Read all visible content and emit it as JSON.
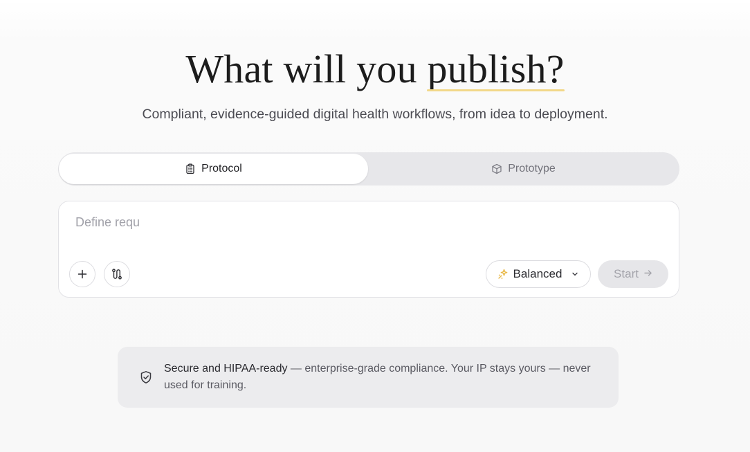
{
  "hero": {
    "title_main": "What will you ",
    "title_accent": "publish?",
    "subtitle": "Compliant, evidence-guided digital health workflows, from idea to deployment."
  },
  "mode_toggle": {
    "tabs": [
      {
        "label": "Protocol",
        "icon": "clipboard-icon",
        "active": true
      },
      {
        "label": "Prototype",
        "icon": "cube-icon",
        "active": false
      }
    ]
  },
  "composer": {
    "value": "",
    "placeholder": "Define requ",
    "attach_icon": "plus-icon",
    "tools_icon": "route-icon",
    "mode_select": {
      "icon": "sparkle-icon",
      "value": "Balanced",
      "chevron": "chevron-down-icon"
    },
    "start": {
      "label": "Start",
      "icon": "arrow-right-icon"
    }
  },
  "notice": {
    "icon": "shield-check-icon",
    "title": "Secure and HIPAA-ready",
    "body": " — enterprise-grade compliance. Your IP stays yours — never used for training."
  },
  "colors": {
    "accent_underline": "#f2d889",
    "sparkle": "#e9b949",
    "background": "#fafafa"
  }
}
